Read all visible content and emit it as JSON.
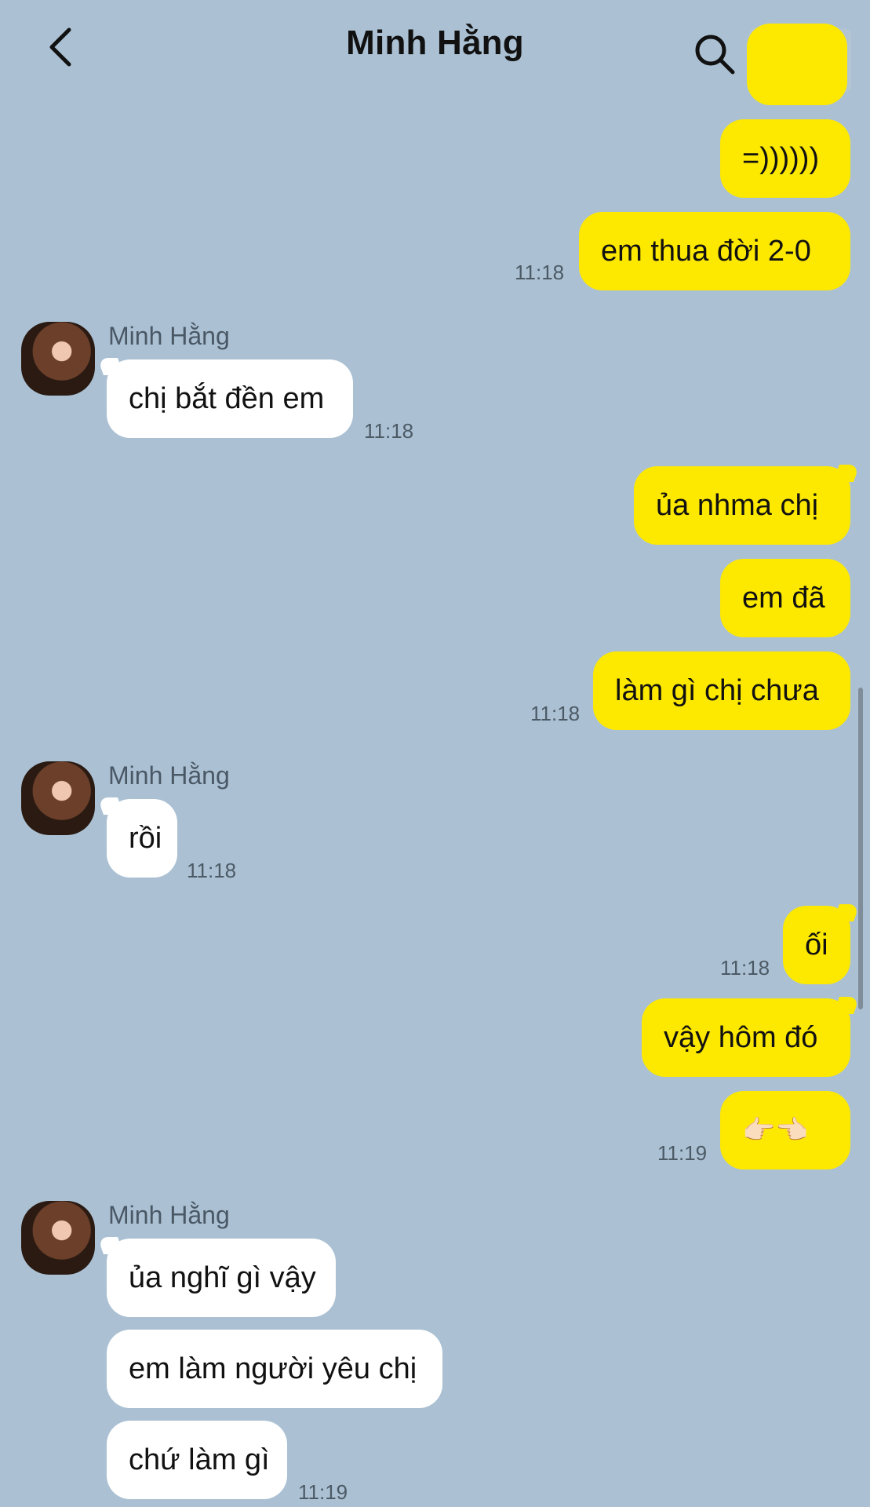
{
  "header": {
    "title": "Minh Hằng"
  },
  "messages": [
    {
      "from": "me",
      "text": "=))))))"
    },
    {
      "from": "me",
      "text": "em thua đời 2-0",
      "time": "11:18"
    },
    {
      "from": "them",
      "sender": "Minh Hằng",
      "text": "chị bắt đền em",
      "time": "11:18"
    },
    {
      "from": "me",
      "text": "ủa nhma chị"
    },
    {
      "from": "me",
      "text": "em đã"
    },
    {
      "from": "me",
      "text": "làm gì chị chưa",
      "time": "11:18"
    },
    {
      "from": "them",
      "sender": "Minh Hằng",
      "text": "rồi",
      "time": "11:18"
    },
    {
      "from": "me",
      "text": "ối",
      "time": "11:18"
    },
    {
      "from": "me",
      "text": "vậy hôm đó"
    },
    {
      "from": "me",
      "text": "👉🏻👈🏻",
      "time": "11:19"
    },
    {
      "from": "them",
      "sender": "Minh Hằng",
      "text": "ủa nghĩ gì vậy"
    },
    {
      "from": "them",
      "text": "em làm người yêu chị"
    },
    {
      "from": "them",
      "text": "chứ làm gì",
      "time": "11:19"
    }
  ],
  "colors": {
    "background": "#abc1d3",
    "my_bubble": "#fde800",
    "their_bubble": "#ffffff"
  },
  "icons": [
    "chevron-left-icon",
    "search-icon",
    "menu-icon"
  ]
}
